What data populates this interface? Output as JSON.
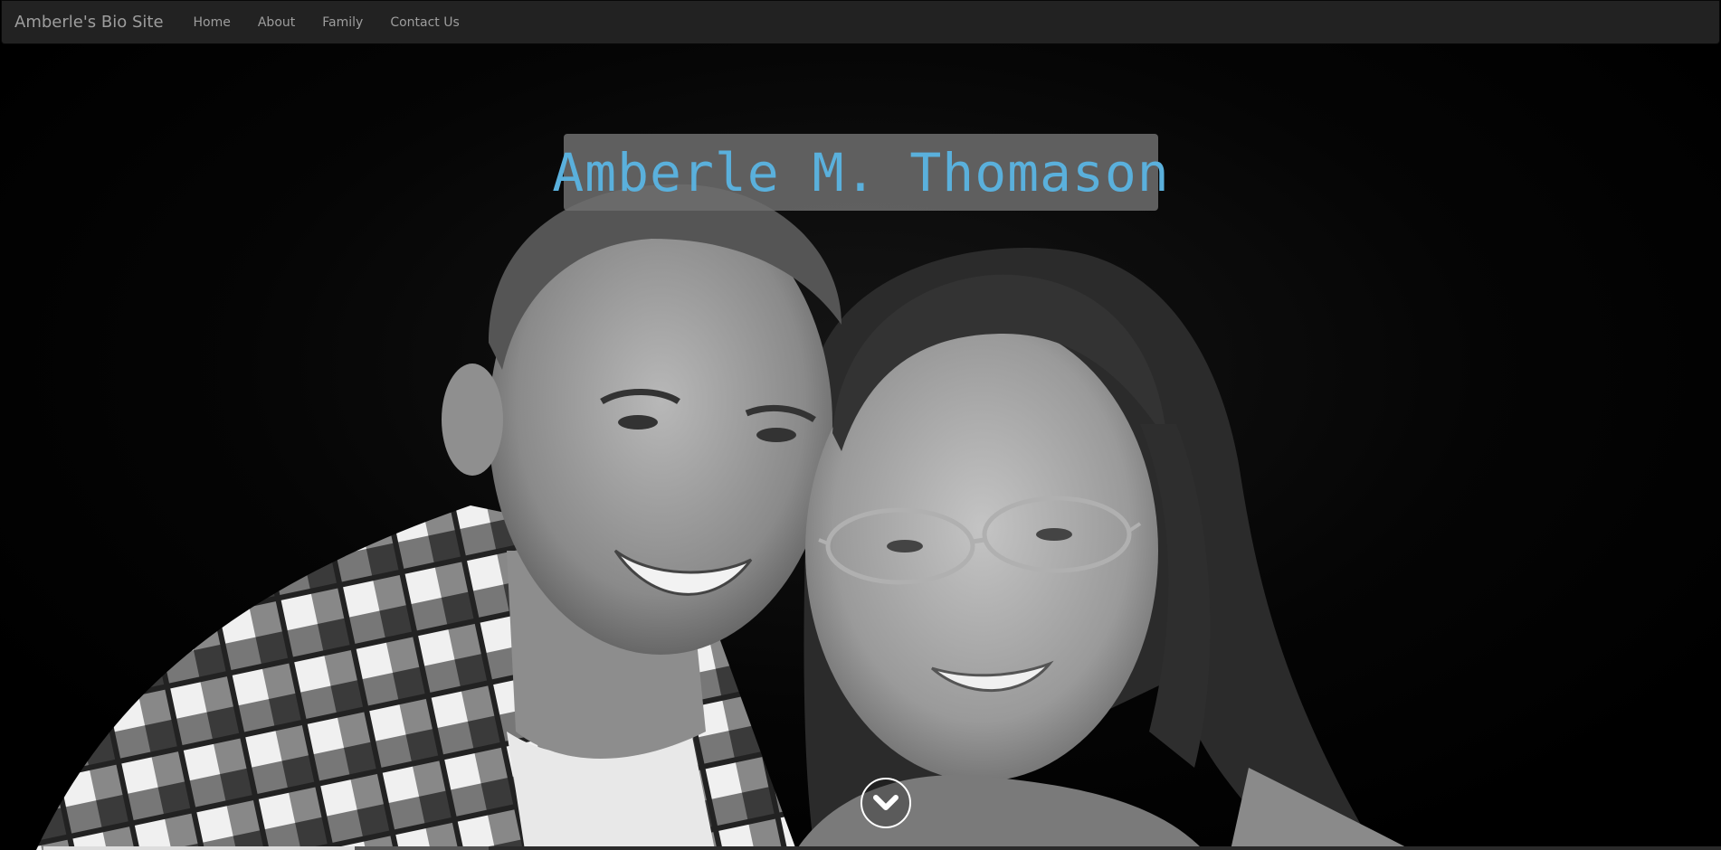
{
  "navbar": {
    "brand": "Amberle's Bio Site",
    "links": [
      "Home",
      "About",
      "Family",
      "Contact Us"
    ]
  },
  "hero": {
    "title": "Amberle M. Thomason",
    "scroll_icon": "chevron-down-icon",
    "title_color": "#5ab0dc"
  }
}
